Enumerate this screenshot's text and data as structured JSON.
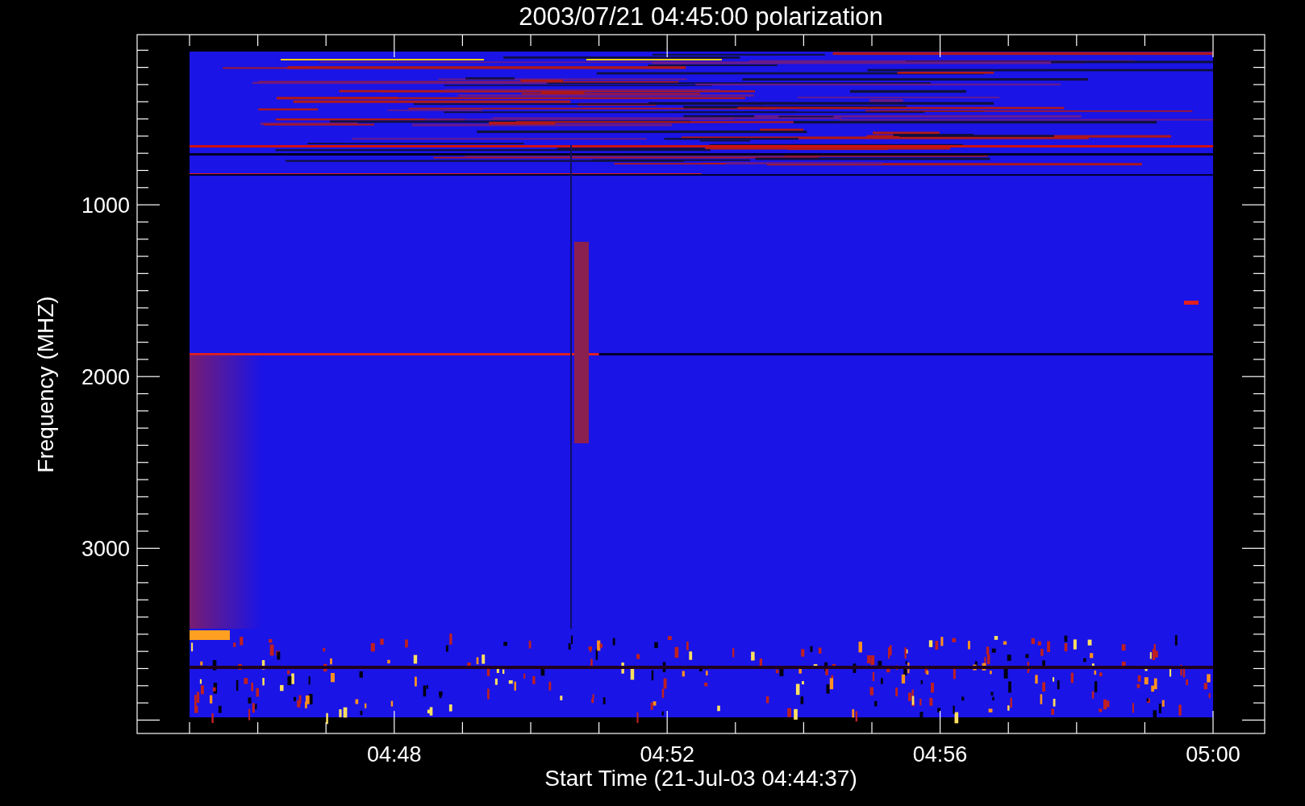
{
  "title": "2003/07/21 04:45:00 polarization",
  "plot": {
    "xlabel": "Start Time (21-Jul-03 04:44:37)",
    "ylabel": "Frequency (MHZ)",
    "xticks": [
      "04:48",
      "04:52",
      "04:56",
      "05:00"
    ],
    "yticks": [
      "1000",
      "2000",
      "3000"
    ]
  }
}
